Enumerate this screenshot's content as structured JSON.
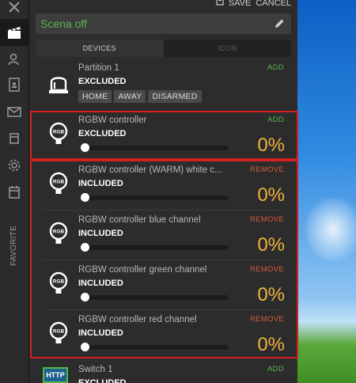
{
  "header": {
    "save_label": "SAVE",
    "cancel_label": "CANCEL"
  },
  "scene": {
    "name": "Scena off"
  },
  "tabs": [
    {
      "label": "DEVICES"
    },
    {
      "label": "ICON"
    }
  ],
  "sidebar": {
    "favorite_label": "FAVORITE"
  },
  "partition": {
    "name": "Partition 1",
    "state": "EXCLUDED",
    "action": "ADD",
    "modes": [
      "HOME",
      "AWAY",
      "DISARMED"
    ]
  },
  "devices": [
    {
      "name": "RGBW controller",
      "state": "EXCLUDED",
      "action": "ADD",
      "percent": "0%",
      "level": 0
    },
    {
      "name": "RGBW controller (WARM) white c...",
      "state": "INCLUDED",
      "action": "REMOVE",
      "percent": "0%",
      "level": 0
    },
    {
      "name": "RGBW controller blue channel",
      "state": "INCLUDED",
      "action": "REMOVE",
      "percent": "0%",
      "level": 0
    },
    {
      "name": "RGBW controller green channel",
      "state": "INCLUDED",
      "action": "REMOVE",
      "percent": "0%",
      "level": 0
    },
    {
      "name": "RGBW controller red channel",
      "state": "INCLUDED",
      "action": "REMOVE",
      "percent": "0%",
      "level": 0
    }
  ],
  "switch": {
    "name": "Switch 1",
    "state": "EXCLUDED",
    "action": "ADD",
    "icon_text": "HTTP"
  },
  "icon_label": "RGB",
  "colors": {
    "accent_green": "#56b84a",
    "remove_red": "#d95a3a",
    "percent_orange": "#f0b33c",
    "highlight_red": "#d32020"
  }
}
